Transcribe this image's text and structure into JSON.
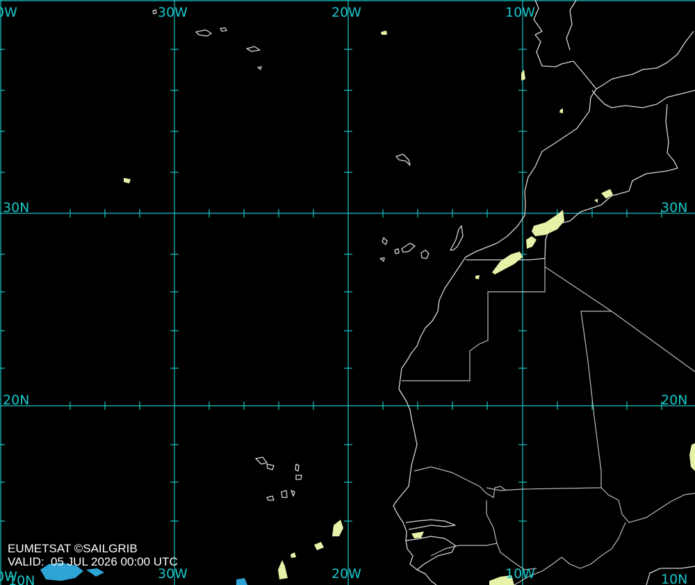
{
  "credits": {
    "source": "EUMETSAT ©SAILGRIB",
    "valid": "VALID:  05 JUL 2026 00:00 UTC"
  },
  "labels": {
    "lon_top": [
      "0W",
      "30W",
      "20W",
      "10W"
    ],
    "lat_left": [
      "30N",
      "20N"
    ],
    "lat_right": [
      "30N",
      "20N"
    ],
    "lon_bottom": [
      "0W",
      "30W",
      "20W",
      "10W",
      "10N"
    ],
    "corner_bottom_left": "10N"
  },
  "colors": {
    "grid": "#17c7c9",
    "coast": "#d9d9d9",
    "cloud": "#e6f2a8",
    "cloud_cold": "#2ea3d6"
  }
}
